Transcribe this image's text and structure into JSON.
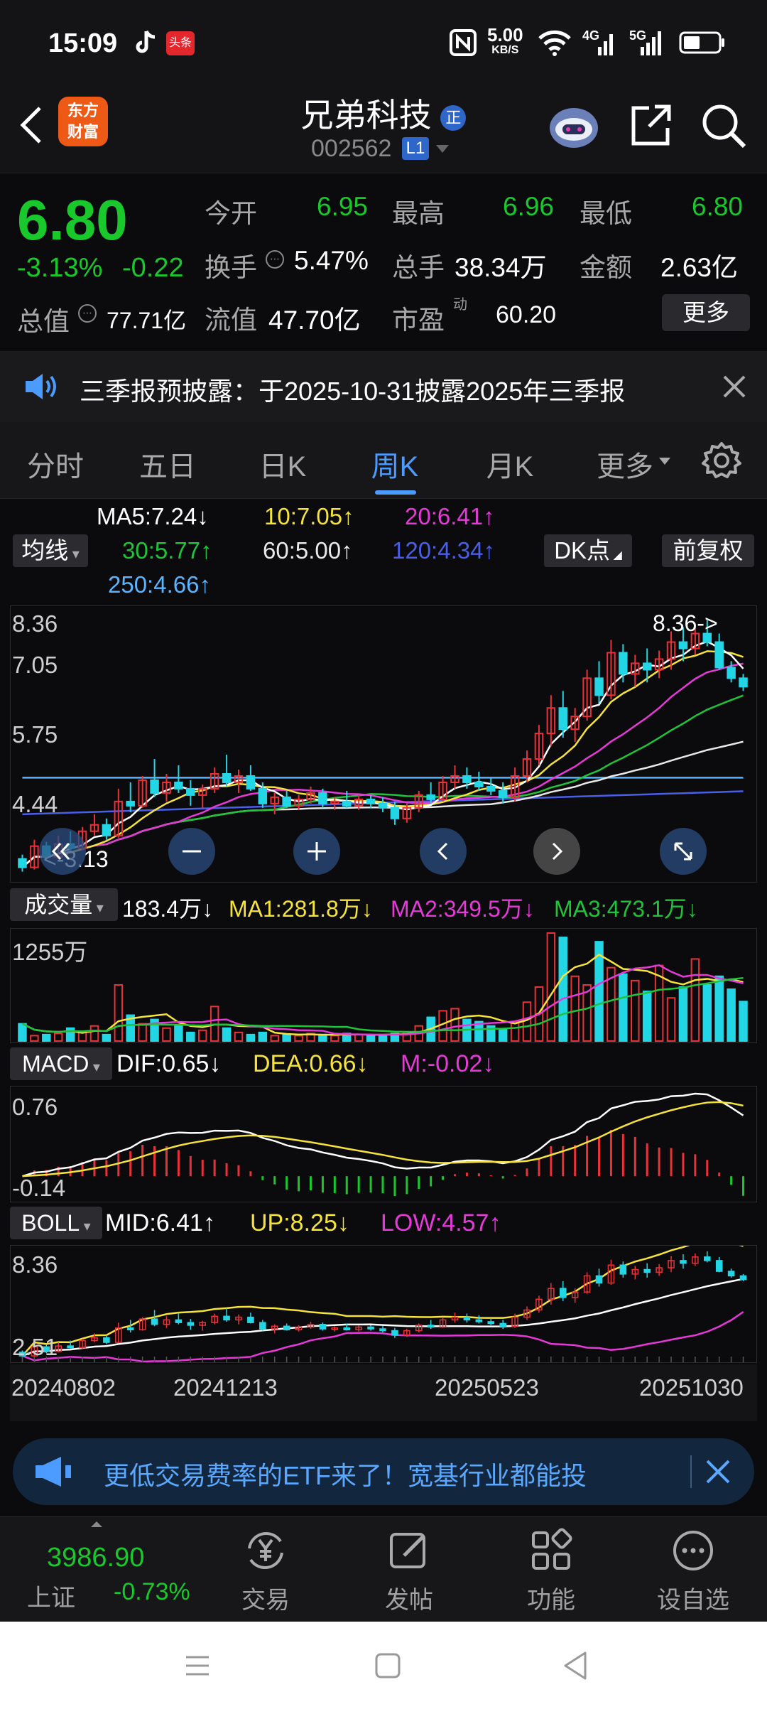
{
  "status_bar": {
    "time": "15:09",
    "net_speed": "5.00",
    "net_unit": "KB/S",
    "signal_1": "4G",
    "signal_2": "5G",
    "app_icons": [
      "tiktok-icon",
      "toutiao-icon"
    ],
    "toutiao_label": "头条"
  },
  "header": {
    "title": "兄弟科技",
    "badge": "正",
    "code": "002562",
    "level": "L1",
    "logo_line1": "东方",
    "logo_line2": "财富"
  },
  "quote": {
    "price": "6.80",
    "change_pct": "-3.13%",
    "change": "-0.22",
    "open_label": "今开",
    "open": "6.95",
    "high_label": "最高",
    "high": "6.96",
    "low_label": "最低",
    "low": "6.80",
    "turnover_label": "换手",
    "turnover": "5.47%",
    "volume_label": "总手",
    "volume": "38.34万",
    "amount_label": "金额",
    "amount": "2.63亿",
    "mktcap_label": "总值",
    "mktcap": "77.71亿",
    "float_label": "流值",
    "float_cap": "47.70亿",
    "pe_label": "市盈",
    "pe_sup": "动",
    "pe": "60.20",
    "more_label": "更多"
  },
  "notice": {
    "text": "三季报预披露：于2025-10-31披露2025年三季报"
  },
  "tabs": [
    {
      "label": "分时"
    },
    {
      "label": "五日"
    },
    {
      "label": "日K"
    },
    {
      "label": "周K"
    },
    {
      "label": "月K"
    },
    {
      "label": "更多"
    }
  ],
  "ma_legend": {
    "ma5": "MA5:7.24↓",
    "ma10": "10:7.05↑",
    "ma20": "20:6.41↑",
    "ma30": "30:5.77↑",
    "ma60": "60:5.00↑",
    "ma120": "120:4.34↑",
    "ma250": "250:4.66↑",
    "junxian": "均线",
    "dk": "DK点",
    "fuquan": "前复权"
  },
  "kline": {
    "y_labels": [
      "8.36",
      "7.05",
      "5.75",
      "4.44"
    ],
    "max_marker": "8.36->",
    "min_marker": "<-3.13"
  },
  "volume": {
    "label": "成交量",
    "current": "183.4万↓",
    "ma1": "MA1:281.8万↓",
    "ma2": "MA2:349.5万↓",
    "ma3": "MA3:473.1万↓",
    "y_label": "1255万"
  },
  "macd": {
    "label": "MACD",
    "dif": "DIF:0.65↓",
    "dea": "DEA:0.66↓",
    "m": "M:-0.02↓",
    "y_top": "0.76",
    "y_bottom": "-0.14"
  },
  "boll": {
    "label": "BOLL",
    "mid": "MID:6.41↑",
    "up": "UP:8.25↓",
    "low": "LOW:4.57↑",
    "y_top": "8.36",
    "y_bottom": "2.51"
  },
  "x_axis": [
    "20240802",
    "20241213",
    "20250523",
    "20251030"
  ],
  "banner": {
    "text": "更低交易费率的ETF来了！宽基行业都能投"
  },
  "bottom_bar": {
    "index_value": "3986.90",
    "index_name": "上证",
    "index_change": "-0.73%",
    "trade": "交易",
    "post": "发帖",
    "features": "功能",
    "watchlist": "设自选"
  },
  "colors": {
    "up": "#e8323a",
    "down": "#19c82a",
    "accent": "#4c9bff",
    "ma5": "#ffffff",
    "ma10": "#f5e33c",
    "ma20": "#e53ad8",
    "ma30": "#1fc43a",
    "ma60": "#e8e8e8",
    "ma120": "#4a5fe8",
    "ma250": "#5ab4ff"
  },
  "chart_data": {
    "type": "candlestick",
    "period": "weekly",
    "y_range": [
      2.51,
      8.36
    ],
    "candles": [
      [
        2.75,
        2.85,
        2.45,
        2.55
      ],
      [
        2.55,
        3.2,
        2.5,
        3.05
      ],
      [
        3.05,
        3.15,
        2.7,
        2.8
      ],
      [
        2.8,
        3.3,
        2.75,
        3.1
      ],
      [
        3.1,
        3.4,
        2.95,
        3.0
      ],
      [
        3.0,
        3.5,
        2.95,
        3.4
      ],
      [
        3.4,
        3.8,
        3.3,
        3.55
      ],
      [
        3.55,
        3.7,
        3.2,
        3.3
      ],
      [
        3.3,
        4.4,
        3.25,
        4.1
      ],
      [
        4.1,
        4.55,
        3.85,
        4.0
      ],
      [
        4.0,
        4.7,
        3.95,
        4.6
      ],
      [
        4.6,
        5.1,
        4.2,
        4.3
      ],
      [
        4.3,
        4.75,
        4.1,
        4.55
      ],
      [
        4.55,
        4.95,
        4.3,
        4.4
      ],
      [
        4.4,
        4.6,
        4.0,
        4.25
      ],
      [
        4.25,
        4.5,
        3.95,
        4.4
      ],
      [
        4.4,
        4.9,
        4.3,
        4.75
      ],
      [
        4.75,
        5.2,
        4.45,
        4.55
      ],
      [
        4.55,
        4.85,
        4.3,
        4.7
      ],
      [
        4.7,
        4.95,
        4.35,
        4.4
      ],
      [
        4.4,
        4.55,
        3.95,
        4.05
      ],
      [
        4.05,
        4.3,
        3.8,
        4.2
      ],
      [
        4.2,
        4.35,
        3.95,
        4.0
      ],
      [
        4.0,
        4.25,
        3.9,
        4.15
      ],
      [
        4.15,
        4.45,
        4.05,
        4.3
      ],
      [
        4.3,
        4.4,
        3.95,
        4.05
      ],
      [
        4.05,
        4.2,
        3.9,
        4.1
      ],
      [
        4.1,
        4.35,
        3.95,
        4.0
      ],
      [
        4.0,
        4.25,
        3.9,
        4.15
      ],
      [
        4.15,
        4.25,
        3.95,
        4.05
      ],
      [
        4.05,
        4.2,
        3.85,
        3.95
      ],
      [
        3.95,
        4.1,
        3.55,
        3.7
      ],
      [
        3.7,
        4.05,
        3.6,
        3.95
      ],
      [
        3.95,
        4.35,
        3.85,
        4.25
      ],
      [
        4.25,
        4.55,
        4.05,
        4.15
      ],
      [
        4.15,
        4.7,
        4.1,
        4.55
      ],
      [
        4.55,
        4.95,
        4.4,
        4.7
      ],
      [
        4.7,
        4.9,
        4.4,
        4.55
      ],
      [
        4.55,
        4.8,
        4.35,
        4.45
      ],
      [
        4.45,
        4.65,
        4.25,
        4.35
      ],
      [
        4.35,
        4.55,
        4.05,
        4.2
      ],
      [
        4.2,
        4.9,
        4.1,
        4.7
      ],
      [
        4.7,
        5.3,
        4.55,
        5.1
      ],
      [
        5.1,
        5.9,
        4.95,
        5.7
      ],
      [
        5.7,
        6.6,
        5.4,
        6.3
      ],
      [
        6.3,
        6.7,
        5.6,
        5.8
      ],
      [
        5.8,
        6.3,
        5.5,
        6.1
      ],
      [
        6.1,
        7.2,
        6.0,
        7.0
      ],
      [
        7.0,
        7.4,
        6.4,
        6.6
      ],
      [
        6.6,
        7.9,
        6.5,
        7.6
      ],
      [
        7.6,
        7.8,
        6.9,
        7.1
      ],
      [
        7.1,
        7.55,
        6.8,
        7.35
      ],
      [
        7.35,
        7.7,
        6.9,
        7.2
      ],
      [
        7.2,
        7.65,
        7.0,
        7.45
      ],
      [
        7.45,
        8.1,
        7.2,
        7.85
      ],
      [
        7.85,
        8.2,
        7.4,
        7.7
      ],
      [
        7.7,
        8.25,
        7.55,
        8.05
      ],
      [
        8.05,
        8.36,
        7.75,
        7.85
      ],
      [
        7.85,
        8.05,
        7.2,
        7.25
      ],
      [
        7.25,
        7.4,
        6.9,
        7.0
      ],
      [
        7.0,
        7.1,
        6.7,
        6.8
      ]
    ],
    "volumes": [
      80,
      25,
      30,
      35,
      60,
      40,
      70,
      30,
      260,
      120,
      80,
      100,
      60,
      70,
      40,
      50,
      160,
      60,
      40,
      30,
      40,
      25,
      30,
      25,
      35,
      30,
      25,
      35,
      30,
      25,
      30,
      35,
      40,
      70,
      110,
      140,
      150,
      100,
      90,
      70,
      55,
      90,
      180,
      250,
      500,
      480,
      300,
      260,
      460,
      340,
      310,
      280,
      230,
      350,
      200,
      250,
      380,
      260,
      300,
      240,
      183
    ],
    "ma": {
      "MA5": {
        "from": 3.05,
        "to": 7.24
      },
      "MA10": {
        "from": 2.95,
        "to": 7.05
      },
      "MA20": {
        "from": 2.85,
        "to": 6.41
      },
      "MA30": {
        "from": 2.9,
        "to": 5.77
      },
      "MA60": {
        "from": 2.8,
        "to": 5.0
      },
      "MA120": {
        "from": 3.8,
        "to": 4.34
      },
      "MA250": {
        "from": 4.66,
        "to": 4.66
      }
    }
  }
}
